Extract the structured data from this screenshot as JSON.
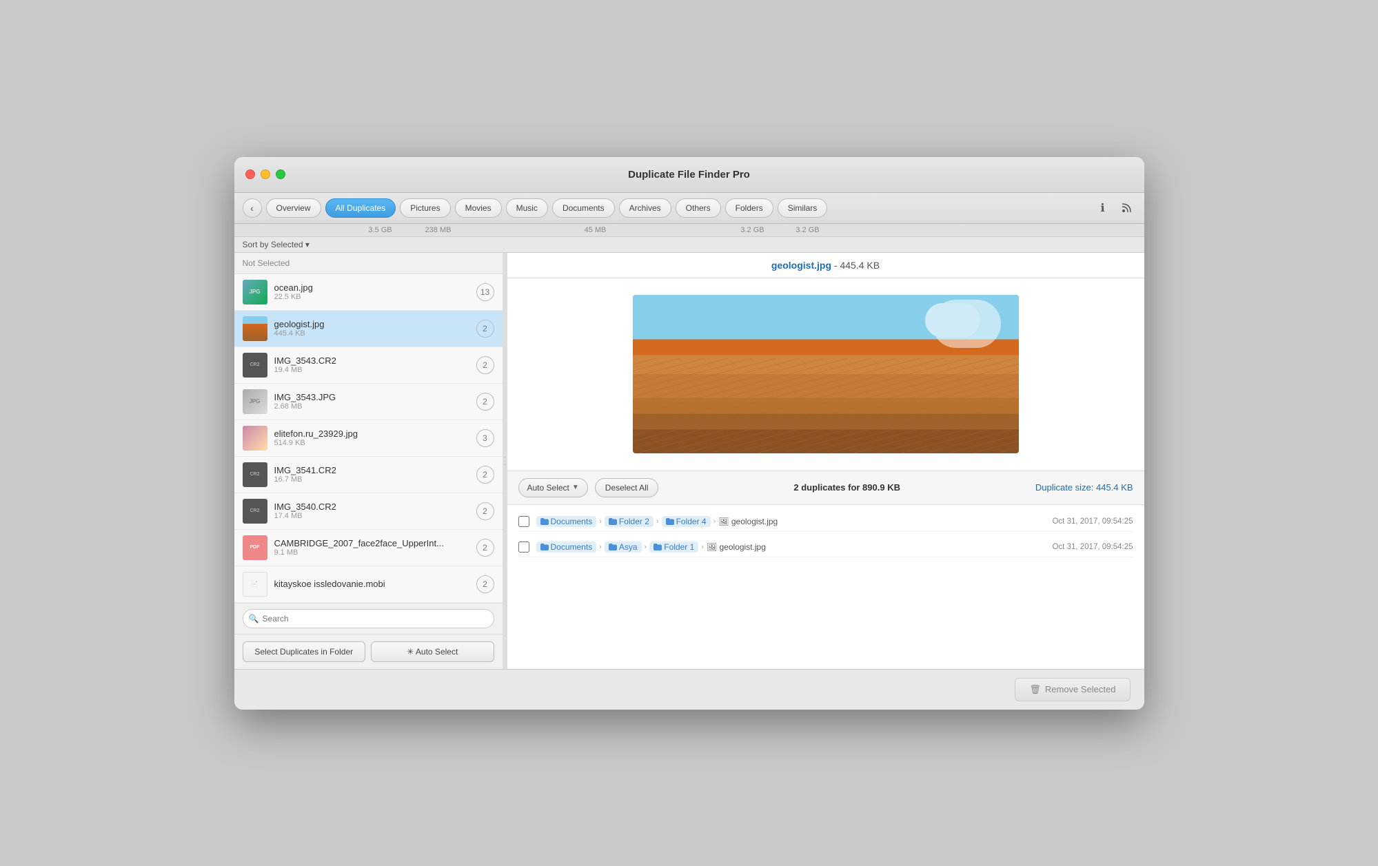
{
  "window": {
    "title": "Duplicate File Finder Pro"
  },
  "toolbar": {
    "back_label": "‹",
    "tabs": [
      {
        "id": "overview",
        "label": "Overview",
        "active": false,
        "size": ""
      },
      {
        "id": "all-duplicates",
        "label": "All Duplicates",
        "active": true,
        "size": "3.5 GB"
      },
      {
        "id": "pictures",
        "label": "Pictures",
        "active": false,
        "size": "238 MB"
      },
      {
        "id": "movies",
        "label": "Movies",
        "active": false,
        "size": ""
      },
      {
        "id": "music",
        "label": "Music",
        "active": false,
        "size": ""
      },
      {
        "id": "documents",
        "label": "Documents",
        "active": false,
        "size": "45 MB"
      },
      {
        "id": "archives",
        "label": "Archives",
        "active": false,
        "size": ""
      },
      {
        "id": "others",
        "label": "Others",
        "active": false,
        "size": ""
      },
      {
        "id": "folders",
        "label": "Folders",
        "active": false,
        "size": "3.2 GB"
      },
      {
        "id": "similars",
        "label": "Similars",
        "active": false,
        "size": "3.2 GB"
      }
    ]
  },
  "sort": {
    "label": "Sort by Selected ▾"
  },
  "sidebar": {
    "header": "Not Selected",
    "files": [
      {
        "name": "ocean.jpg",
        "size": "22.5 KB",
        "count": 13,
        "type": "jpg",
        "selected": false
      },
      {
        "name": "geologist.jpg",
        "size": "445.4 KB",
        "count": 2,
        "type": "jpg",
        "selected": true
      },
      {
        "name": "IMG_3543.CR2",
        "size": "19.4 MB",
        "count": 2,
        "type": "cr2",
        "selected": false
      },
      {
        "name": "IMG_3543.JPG",
        "size": "2.68 MB",
        "count": 2,
        "type": "jpg",
        "selected": false
      },
      {
        "name": "elitefon.ru_23929.jpg",
        "size": "514.9 KB",
        "count": 3,
        "type": "jpg",
        "selected": false
      },
      {
        "name": "IMG_3541.CR2",
        "size": "16.7 MB",
        "count": 2,
        "type": "cr2",
        "selected": false
      },
      {
        "name": "IMG_3540.CR2",
        "size": "17.4 MB",
        "count": 2,
        "type": "cr2",
        "selected": false
      },
      {
        "name": "CAMBRIDGE_2007_face2face_UpperInt...",
        "size": "9.1 MB",
        "count": 2,
        "type": "pdf",
        "selected": false
      },
      {
        "name": "kitayskoe issledovanie.mobi",
        "size": "",
        "count": 2,
        "type": "mobi",
        "selected": false
      }
    ],
    "search_placeholder": "Search",
    "select_duplicates_btn": "Select Duplicates in Folder",
    "auto_select_btn": "✳ Auto Select"
  },
  "preview": {
    "title": "geologist.jpg",
    "size": "445.4 KB",
    "duplicates_count": "2 duplicates for 890.9 KB",
    "duplicate_size_label": "Duplicate size: 445.4 KB",
    "auto_select_label": "Auto Select",
    "deselect_all_label": "Deselect All",
    "rows": [
      {
        "path_parts": [
          "Documents",
          "Folder 2",
          "Folder 4"
        ],
        "filename": "geologist.jpg",
        "date": "Oct 31, 2017, 09:54:25"
      },
      {
        "path_parts": [
          "Documents",
          "Asya",
          "Folder 1"
        ],
        "filename": "geologist.jpg",
        "date": "Oct 31, 2017, 09:54:25"
      }
    ]
  },
  "bottom_bar": {
    "remove_btn": "Remove Selected"
  },
  "colors": {
    "accent": "#3d9de0",
    "link": "#1a6fb5",
    "selected_bg": "#c8e4f8"
  }
}
